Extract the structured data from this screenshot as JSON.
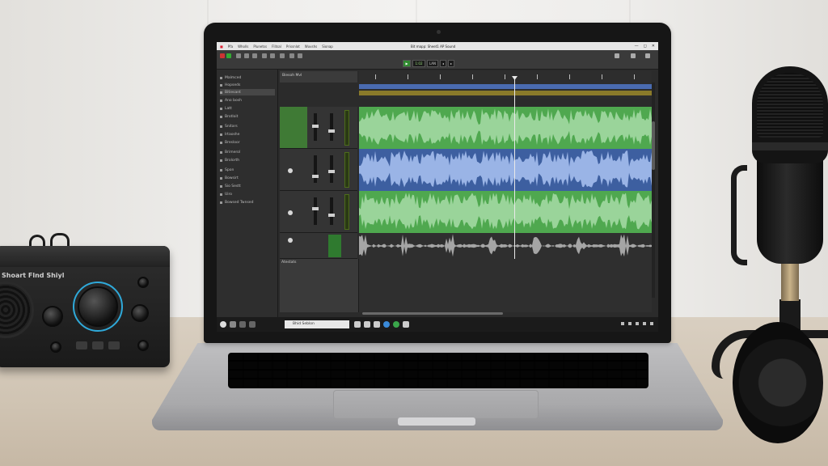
{
  "app": {
    "window_title": "Bit mapp: Sheet1 AP Sound",
    "menu": [
      "Pfa",
      "Wholls",
      "Plunetss",
      "Flitsal",
      "Prissnlot",
      "Wuvshs",
      "Sionap"
    ],
    "window_controls": [
      "—",
      "◻",
      "✕"
    ]
  },
  "transport": {
    "play_label": "▶",
    "time_display": "1:02",
    "mode_label": "LAN"
  },
  "sidebar": {
    "items": [
      {
        "label": "Malmced"
      },
      {
        "label": "Hopseds"
      },
      {
        "label": "Bitiesant",
        "selected": true
      },
      {
        "label": "Ano bosh"
      },
      {
        "label": "Latt"
      },
      {
        "label": "Brotloit"
      },
      {
        "label": "Snitars"
      },
      {
        "label": "Irtaoshe"
      },
      {
        "label": "Bresloor"
      },
      {
        "label": "Brimerol"
      },
      {
        "label": "Brolorth"
      },
      {
        "label": "Spon"
      },
      {
        "label": "Bowsirt"
      },
      {
        "label": "Sio Sestt"
      },
      {
        "label": "Uiro"
      },
      {
        "label": "Bowsed Twnsed"
      }
    ]
  },
  "tracks_header": {
    "label": "Biesoh Mvl"
  },
  "lower_panel": {
    "label": "Atestats"
  },
  "taskbar": {
    "search_text": "Bhid Seblon"
  },
  "colors": {
    "green_clip": "#4fa84f",
    "blue_clip": "#3d5fa0",
    "waveform_light": "#9ad49a",
    "waveform_blue": "#9ab4e6"
  },
  "interface": {
    "label": "Shoart Flnd Shiyl"
  }
}
